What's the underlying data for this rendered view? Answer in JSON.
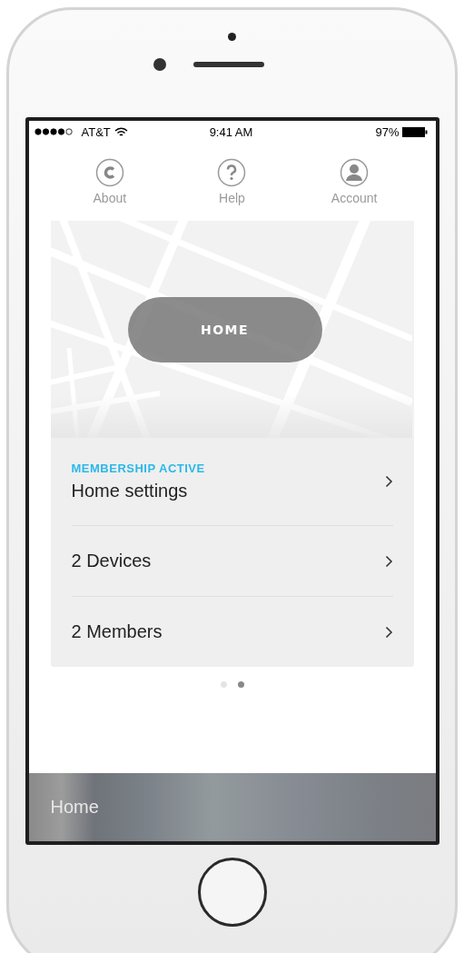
{
  "status_bar": {
    "carrier": "AT&T",
    "time": "9:41 AM",
    "battery": "97%"
  },
  "nav": [
    {
      "label": "About",
      "kind": "about"
    },
    {
      "label": "Help",
      "kind": "help"
    },
    {
      "label": "Account",
      "kind": "account"
    }
  ],
  "map": {
    "pin_button": "HOME"
  },
  "card": {
    "status": "MEMBERSHIP ACTIVE",
    "rows": [
      {
        "label": "Home settings"
      },
      {
        "label": "2 Devices"
      },
      {
        "label": "2 Members"
      }
    ]
  },
  "pager": [
    {
      "selected": false
    },
    {
      "selected": true
    }
  ],
  "bottom_bar": {
    "title": "Home"
  }
}
